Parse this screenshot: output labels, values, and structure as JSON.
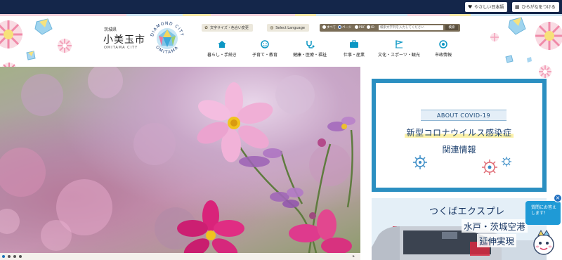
{
  "topbar": {
    "easy_japanese": {
      "label": "やさしい日本語",
      "icon": "heart-icon"
    },
    "furigana": {
      "label": "ひらがなをつける",
      "icon": "furigana-icon"
    }
  },
  "logo": {
    "prefecture": "茨城県",
    "city": "小美玉市",
    "romaji": "OMITAMA CITY",
    "emblem_text_top": "DIAMOND CITY",
    "emblem_text_bottom": "OMITAMA"
  },
  "header_buttons": {
    "font_size": {
      "label": "文字サイズ・色合い変更",
      "icon": "gear-icon"
    },
    "language": {
      "label": "Select Language",
      "icon": "globe-icon"
    }
  },
  "search": {
    "options": [
      "すべて",
      "ページ",
      "PDF",
      "ID"
    ],
    "selected": "ページ",
    "placeholder": "検索文字列を入力してください",
    "button": "検索"
  },
  "nav": [
    {
      "label": "暮らし・手続き",
      "icon": "house-icon"
    },
    {
      "label": "子育て・教育",
      "icon": "child-icon"
    },
    {
      "label": "健康・医療・福祉",
      "icon": "stethoscope-icon"
    },
    {
      "label": "仕事・産業",
      "icon": "briefcase-icon"
    },
    {
      "label": "文化・スポーツ・観光",
      "icon": "flag-icon"
    },
    {
      "label": "市政情報",
      "icon": "city-info-icon"
    }
  ],
  "hero": {
    "slide_count": 4,
    "active_slide": 1,
    "next_arrow": "▸"
  },
  "covid_banner": {
    "tag": "ABOUT COVID-19",
    "line1": "新型コロナウイルス感染症",
    "line2": "関連情報"
  },
  "tx_banner": {
    "line1": "つくばエクスプレ",
    "line2": "水戸・茨城空港",
    "line3": "延伸実現"
  },
  "help_widget": {
    "text": "質問にお答えします！",
    "close": "×"
  },
  "colors": {
    "topbar": "#14264a",
    "accent": "#0c97c4",
    "covid_frame": "#2b8fc1",
    "search_bar": "#7a6d57"
  }
}
